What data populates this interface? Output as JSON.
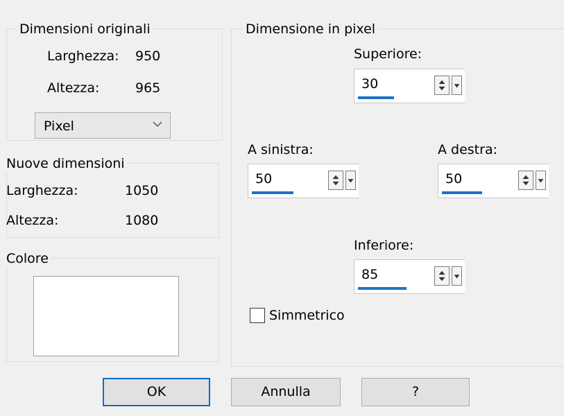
{
  "original": {
    "title": "Dimensioni originali",
    "width_label": "Larghezza:",
    "width_value": "950",
    "height_label": "Altezza:",
    "height_value": "965",
    "unit_select": "Pixel"
  },
  "new_dims": {
    "title": "Nuove dimensioni",
    "width_label": "Larghezza:",
    "width_value": "1050",
    "height_label": "Altezza:",
    "height_value": "1080"
  },
  "color": {
    "title": "Colore",
    "value": "#ffffff"
  },
  "pixel_dims": {
    "title": "Dimensione in pixel",
    "top_label": "Superiore:",
    "top_value": "30",
    "left_label": "A sinistra:",
    "left_value": "50",
    "right_label": "A destra:",
    "right_value": "50",
    "bottom_label": "Inferiore:",
    "bottom_value": "85",
    "symmetric_label": "Simmetrico",
    "symmetric_checked": false
  },
  "buttons": {
    "ok": "OK",
    "cancel": "Annulla",
    "help": "?"
  },
  "colors": {
    "accent": "#1c72c8",
    "background": "#f0f0f0"
  }
}
